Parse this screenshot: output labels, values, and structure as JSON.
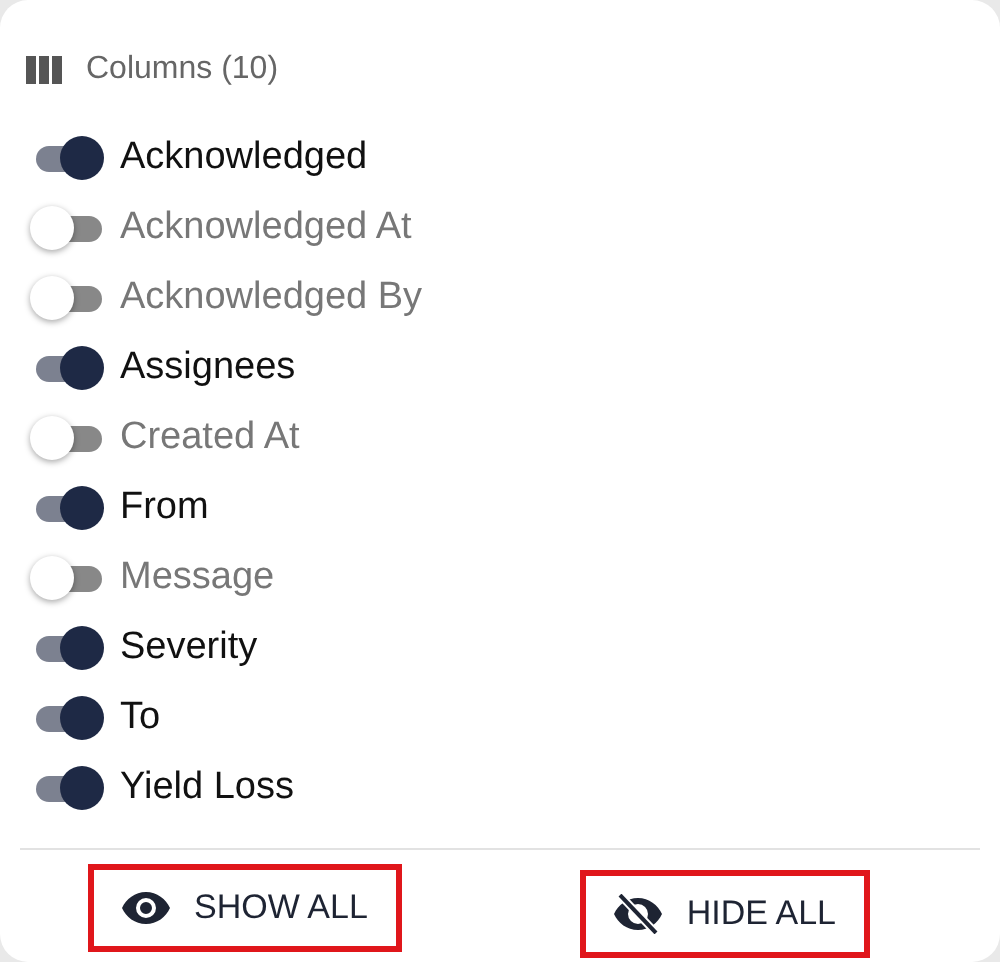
{
  "header": {
    "title": "Columns (10)"
  },
  "columns": [
    {
      "label": "Acknowledged",
      "on": true
    },
    {
      "label": "Acknowledged At",
      "on": false
    },
    {
      "label": "Acknowledged By",
      "on": false
    },
    {
      "label": "Assignees",
      "on": true
    },
    {
      "label": "Created At",
      "on": false
    },
    {
      "label": "From",
      "on": true
    },
    {
      "label": "Message",
      "on": false
    },
    {
      "label": "Severity",
      "on": true
    },
    {
      "label": "To",
      "on": true
    },
    {
      "label": "Yield Loss",
      "on": true
    }
  ],
  "buttons": [
    {
      "kind": "show",
      "label": "SHOW ALL"
    },
    {
      "kind": "hide",
      "label": "HIDE ALL"
    }
  ]
}
